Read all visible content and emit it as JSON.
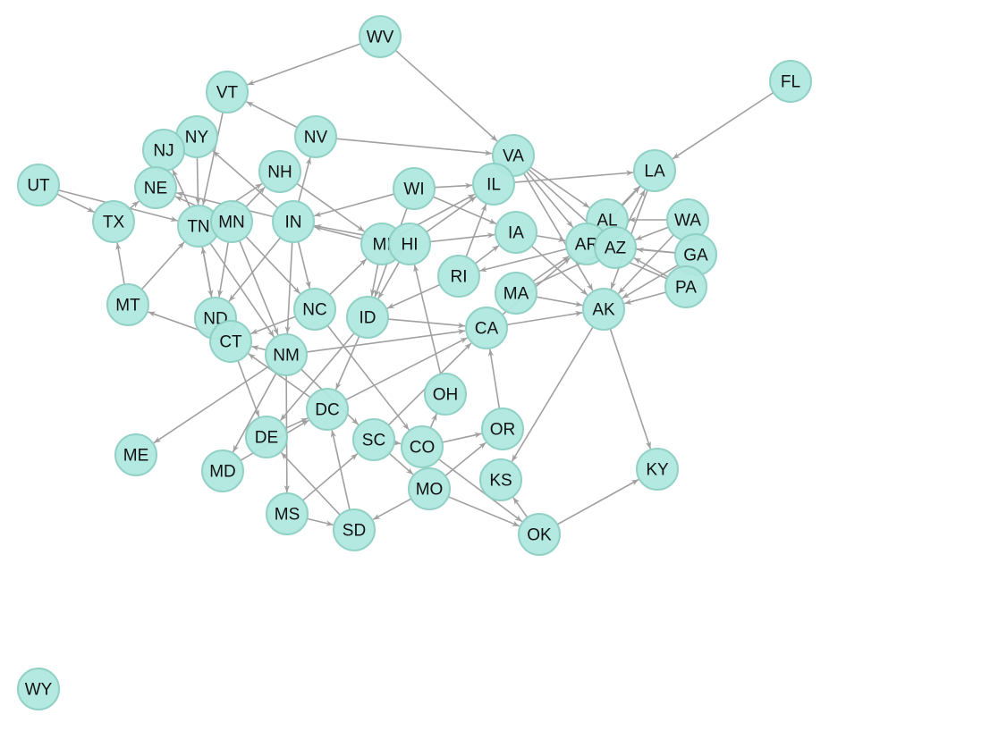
{
  "graph": {
    "directed": true,
    "colors": {
      "node_fill": "#b0e8e0",
      "node_stroke": "#8ccfc3",
      "edge": "#a0a0a0"
    },
    "nodes": [
      "WV",
      "VT",
      "FL",
      "NY",
      "NJ",
      "NV",
      "VA",
      "LA",
      "UT",
      "NH",
      "WI",
      "IL",
      "NE",
      "TX",
      "TN",
      "MN",
      "IN",
      "MI",
      "HI",
      "IA",
      "AL",
      "WA",
      "AR",
      "AZ",
      "GA",
      "RI",
      "PA",
      "MT",
      "MA",
      "ND",
      "NC",
      "ID",
      "AK",
      "CA",
      "CT",
      "NM",
      "OH",
      "DC",
      "OR",
      "ME",
      "DE",
      "SC",
      "CO",
      "KY",
      "MD",
      "KS",
      "MO",
      "MS",
      "SD",
      "OK",
      "WY"
    ],
    "edges": [
      [
        "WV",
        "VT"
      ],
      [
        "WV",
        "VA"
      ],
      [
        "FL",
        "LA"
      ],
      [
        "NV",
        "VT"
      ],
      [
        "NV",
        "VA"
      ],
      [
        "UT",
        "TX"
      ],
      [
        "UT",
        "TN"
      ],
      [
        "MT",
        "TX"
      ],
      [
        "MT",
        "TN"
      ],
      [
        "TX",
        "NE"
      ],
      [
        "VT",
        "TN"
      ],
      [
        "NY",
        "TN"
      ],
      [
        "IN",
        "NY"
      ],
      [
        "IN",
        "NE"
      ],
      [
        "IN",
        "NV"
      ],
      [
        "IN",
        "NC"
      ],
      [
        "IN",
        "NM"
      ],
      [
        "IN",
        "ND"
      ],
      [
        "WI",
        "IN"
      ],
      [
        "WI",
        "IL"
      ],
      [
        "WI",
        "IA"
      ],
      [
        "WI",
        "ID"
      ],
      [
        "MI",
        "IN"
      ],
      [
        "HI",
        "IN"
      ],
      [
        "HI",
        "IL"
      ],
      [
        "MI",
        "IL"
      ],
      [
        "HI",
        "IA"
      ],
      [
        "RI",
        "IA"
      ],
      [
        "RI",
        "IL"
      ],
      [
        "RI",
        "ID"
      ],
      [
        "AR",
        "RI"
      ],
      [
        "MI",
        "ID"
      ],
      [
        "HI",
        "ID"
      ],
      [
        "NC",
        "MI"
      ],
      [
        "NC",
        "CT"
      ],
      [
        "NC",
        "CO"
      ],
      [
        "ID",
        "CA"
      ],
      [
        "ID",
        "DC"
      ],
      [
        "ID",
        "DE"
      ],
      [
        "NM",
        "CA"
      ],
      [
        "NM",
        "ME"
      ],
      [
        "NM",
        "MS"
      ],
      [
        "NM",
        "MD"
      ],
      [
        "TN",
        "ND"
      ],
      [
        "ND",
        "TN"
      ],
      [
        "MN",
        "ND"
      ],
      [
        "MN",
        "NC"
      ],
      [
        "MN",
        "NM"
      ],
      [
        "TN",
        "NM"
      ],
      [
        "NH",
        "MI"
      ],
      [
        "MN",
        "NH"
      ],
      [
        "TN",
        "NH"
      ],
      [
        "TN",
        "NJ"
      ],
      [
        "MN",
        "NE"
      ],
      [
        "CT",
        "DE"
      ],
      [
        "CT",
        "MT"
      ],
      [
        "DC",
        "CA"
      ],
      [
        "DC",
        "CT"
      ],
      [
        "DE",
        "DC"
      ],
      [
        "MD",
        "DC"
      ],
      [
        "MS",
        "SC"
      ],
      [
        "MS",
        "SD"
      ],
      [
        "SD",
        "DC"
      ],
      [
        "SD",
        "DE"
      ],
      [
        "SC",
        "CA"
      ],
      [
        "OH",
        "HI"
      ],
      [
        "CO",
        "OH"
      ],
      [
        "CO",
        "OR"
      ],
      [
        "CO",
        "OK"
      ],
      [
        "SC",
        "MO"
      ],
      [
        "SC",
        "CO"
      ],
      [
        "NM",
        "SC"
      ],
      [
        "MO",
        "SD"
      ],
      [
        "MO",
        "OR"
      ],
      [
        "MO",
        "OK"
      ],
      [
        "OK",
        "KS"
      ],
      [
        "OK",
        "KY"
      ],
      [
        "OR",
        "CA"
      ],
      [
        "AK",
        "KS"
      ],
      [
        "AK",
        "KY"
      ],
      [
        "CA",
        "AK"
      ],
      [
        "CA",
        "AR"
      ],
      [
        "MA",
        "AK"
      ],
      [
        "MA",
        "AR"
      ],
      [
        "MA",
        "AZ"
      ],
      [
        "IA",
        "AR"
      ],
      [
        "IA",
        "AK"
      ],
      [
        "IL",
        "LA"
      ],
      [
        "VA",
        "AL"
      ],
      [
        "VA",
        "AR"
      ],
      [
        "VA",
        "AZ"
      ],
      [
        "VA",
        "AK"
      ],
      [
        "AL",
        "LA"
      ],
      [
        "AZ",
        "LA"
      ],
      [
        "AR",
        "LA"
      ],
      [
        "WA",
        "AL"
      ],
      [
        "WA",
        "AZ"
      ],
      [
        "WA",
        "AK"
      ],
      [
        "GA",
        "AZ"
      ],
      [
        "GA",
        "AR"
      ],
      [
        "GA",
        "AK"
      ],
      [
        "PA",
        "AK"
      ],
      [
        "PA",
        "AZ"
      ],
      [
        "PA",
        "AR"
      ],
      [
        "LA",
        "AK"
      ],
      [
        "LA",
        "AR"
      ],
      [
        "NM",
        "CT"
      ]
    ]
  }
}
